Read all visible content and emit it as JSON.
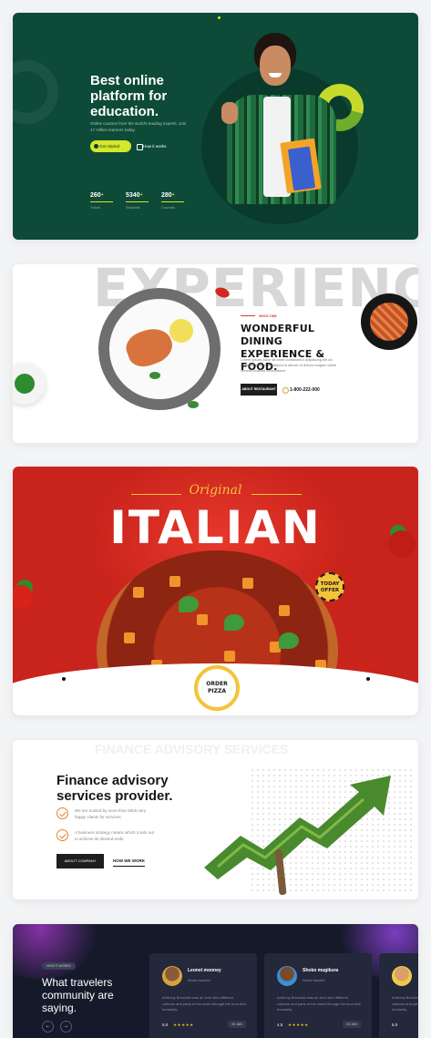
{
  "education": {
    "headline": "Best online platform for education.",
    "subtext": "Online courses from the world's leading experts. Join 17 million learners today.",
    "primary_button": "Get started",
    "secondary_button": "How it works",
    "stats": [
      {
        "value": "260",
        "label": "Tutors"
      },
      {
        "value": "5340",
        "label": "Students"
      },
      {
        "value": "280",
        "label": "Courses"
      }
    ],
    "plus": "+",
    "accent_color": "#d6e62a"
  },
  "dining": {
    "background_word": "EXPERIENCE",
    "tagline": "SINCE 1988",
    "headline": "WONDERFUL DINING EXPERIENCE & FOOD.",
    "description": "Lorem ipsum dolor sit amet consectetur adipiscing elit do eiusmod tempor incididunt ut labore et dolore magna minim veniam nostrud exercitation.",
    "button": "ABOUT RESTAURANT",
    "phone": "1-800-222-000"
  },
  "italian": {
    "script_word": "Original",
    "headline": "ITALIAN",
    "badge": "TODAY OFFER",
    "order_button": "ORDER PIZZA",
    "brand_color": "#c8241c"
  },
  "finance": {
    "ghost_text": "FINANCE ADVISORY SERVICES",
    "headline": "Finance advisory services provider.",
    "points": [
      "We are trusted by more than 5000 very happy clients for services.",
      "A business strategy means which it sets out to achieve its desired ends."
    ],
    "primary_button": "ABOUT COMPANY",
    "secondary_button": "HOW WE WORK"
  },
  "testimonials": {
    "pill": "HOW IT WORKS",
    "headline": "What travelers community are saying.",
    "prev_icon": "←",
    "next_icon": "→",
    "cards": [
      {
        "name": "Leonel mooney",
        "role": "World traveler",
        "quote": "Anthony Bourdain was an icon who different cultures and parts of the world through the food that humanity.",
        "rating": "5.0",
        "stars": "★★★★★",
        "date": "02 JAN"
      },
      {
        "name": "Shoko mugikura",
        "role": "World traveler",
        "quote": "Anthony Bourdain was an icon who different cultures and parts of the world through the food that humanity.",
        "rating": "4.5",
        "stars": "★★★★★",
        "date": "03 JAN"
      },
      {
        "name": "",
        "role": "",
        "quote": "Anthony Bourdain was an icon who different cultures and parts of the world through the food that humanity.",
        "rating": "5.0",
        "stars": "★★★★★",
        "date": ""
      }
    ]
  }
}
